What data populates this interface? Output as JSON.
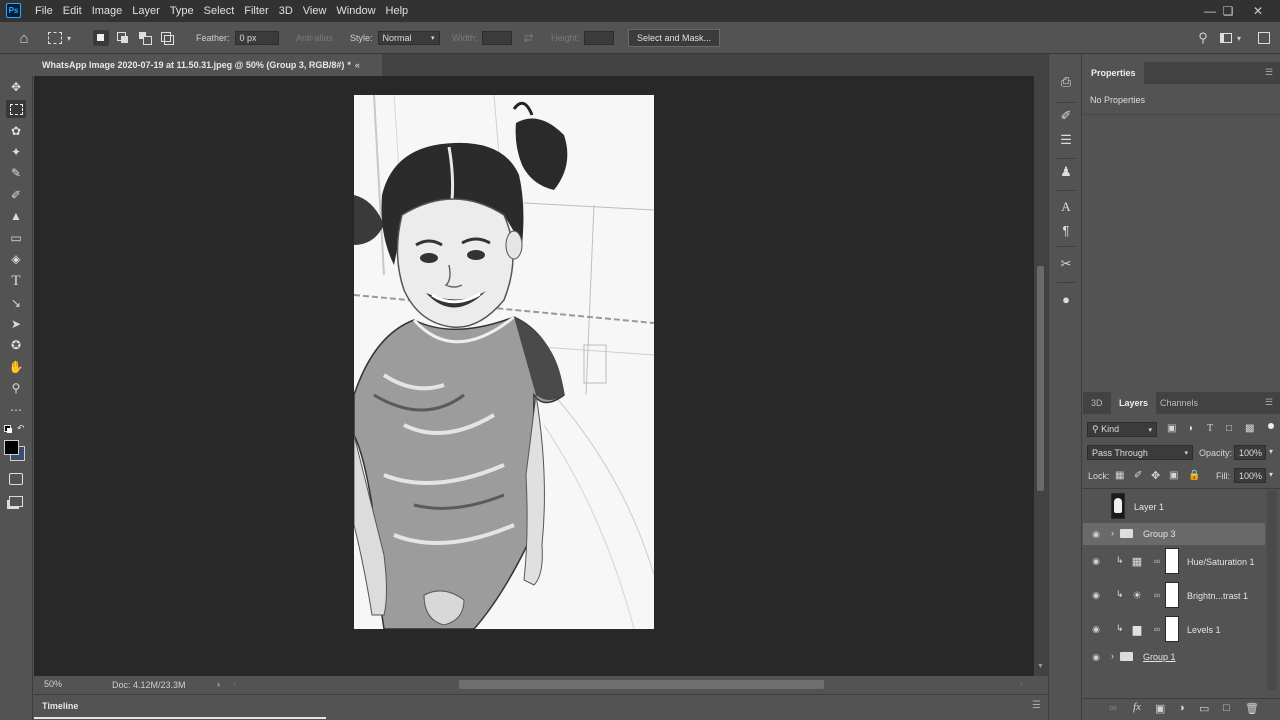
{
  "app": {
    "logo": "Ps"
  },
  "menu": [
    "File",
    "Edit",
    "Image",
    "Layer",
    "Type",
    "Select",
    "Filter",
    "3D",
    "View",
    "Window",
    "Help"
  ],
  "options": {
    "feather_label": "Feather:",
    "feather_value": "0 px",
    "antialias_label": "Anti-alias",
    "style_label": "Style:",
    "style_value": "Normal",
    "width_label": "Width:",
    "height_label": "Height:",
    "select_mask_label": "Select and Mask..."
  },
  "document": {
    "tab_title": "WhatsApp Image 2020-07-19 at 11.50.31.jpeg @ 50% (Group 3, RGB/8#)",
    "tab_suffix": "*"
  },
  "status": {
    "zoom": "50%",
    "doc": "Doc: 4.12M/23.3M"
  },
  "timeline": {
    "label": "Timeline"
  },
  "properties": {
    "tab": "Properties",
    "empty": "No Properties"
  },
  "layers_panel": {
    "tabs": [
      "3D",
      "Layers",
      "Channels"
    ],
    "filter_kind": "Kind",
    "blend_mode": "Pass Through",
    "opacity_label": "Opacity:",
    "opacity_value": "100%",
    "lock_label": "Lock:",
    "fill_label": "Fill:",
    "fill_value": "100%",
    "layers": [
      {
        "name": "Layer 1",
        "visible": false
      },
      {
        "name": "Group 3",
        "visible": true,
        "selected": true
      },
      {
        "name": "Hue/Saturation 1",
        "visible": true
      },
      {
        "name": "Brightn...trast 1",
        "visible": true
      },
      {
        "name": "Levels 1",
        "visible": true
      },
      {
        "name": "Group 1",
        "visible": true
      }
    ]
  },
  "colors": {
    "foreground": "#000000",
    "background": "#3a4f6a",
    "accent": "#31a8ff"
  }
}
